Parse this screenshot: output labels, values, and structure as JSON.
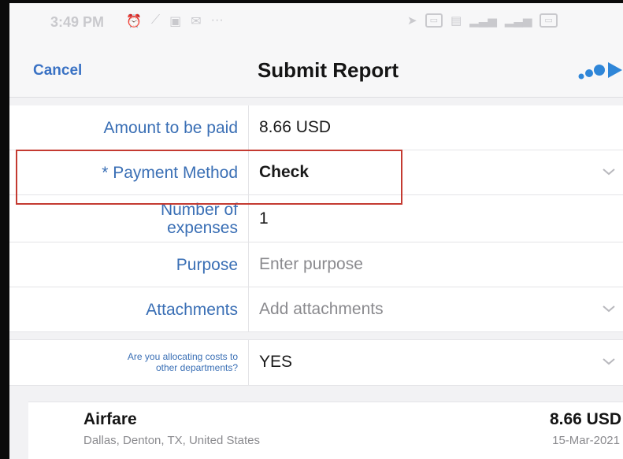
{
  "status_bar": {
    "time": "3:49 PM",
    "left_icons": [
      "alarm-icon",
      "mute-icon",
      "sim-icon",
      "notification-icon",
      "more-dots-icon"
    ],
    "right_icons": [
      "location-icon",
      "vpn-icon",
      "wifi-icon",
      "signal-icon",
      "signal-icon",
      "battery-icon"
    ]
  },
  "nav": {
    "cancel_label": "Cancel",
    "title": "Submit Report",
    "submit_icon": "submit-arrow-icon",
    "accent_color": "#3a72c4"
  },
  "form": {
    "rows": [
      {
        "label": "Amount to be paid",
        "value": "8.66 USD"
      },
      {
        "label": "* Payment Method",
        "value": "Check",
        "highlight_color": "#c43a31"
      },
      {
        "label_line1": "Number of",
        "label_line2": "expenses",
        "value": "1"
      },
      {
        "label": "Purpose",
        "placeholder": "Enter purpose"
      },
      {
        "label": "Attachments",
        "placeholder": "Add attachments"
      }
    ],
    "allocation": {
      "label_line1": "Are you allocating costs to",
      "label_line2": "other departments?",
      "value": "YES"
    }
  },
  "expense": {
    "name": "Airfare",
    "location": "Dallas, Denton, TX, United States",
    "amount": "8.66 USD",
    "date": "15-Mar-2021"
  }
}
